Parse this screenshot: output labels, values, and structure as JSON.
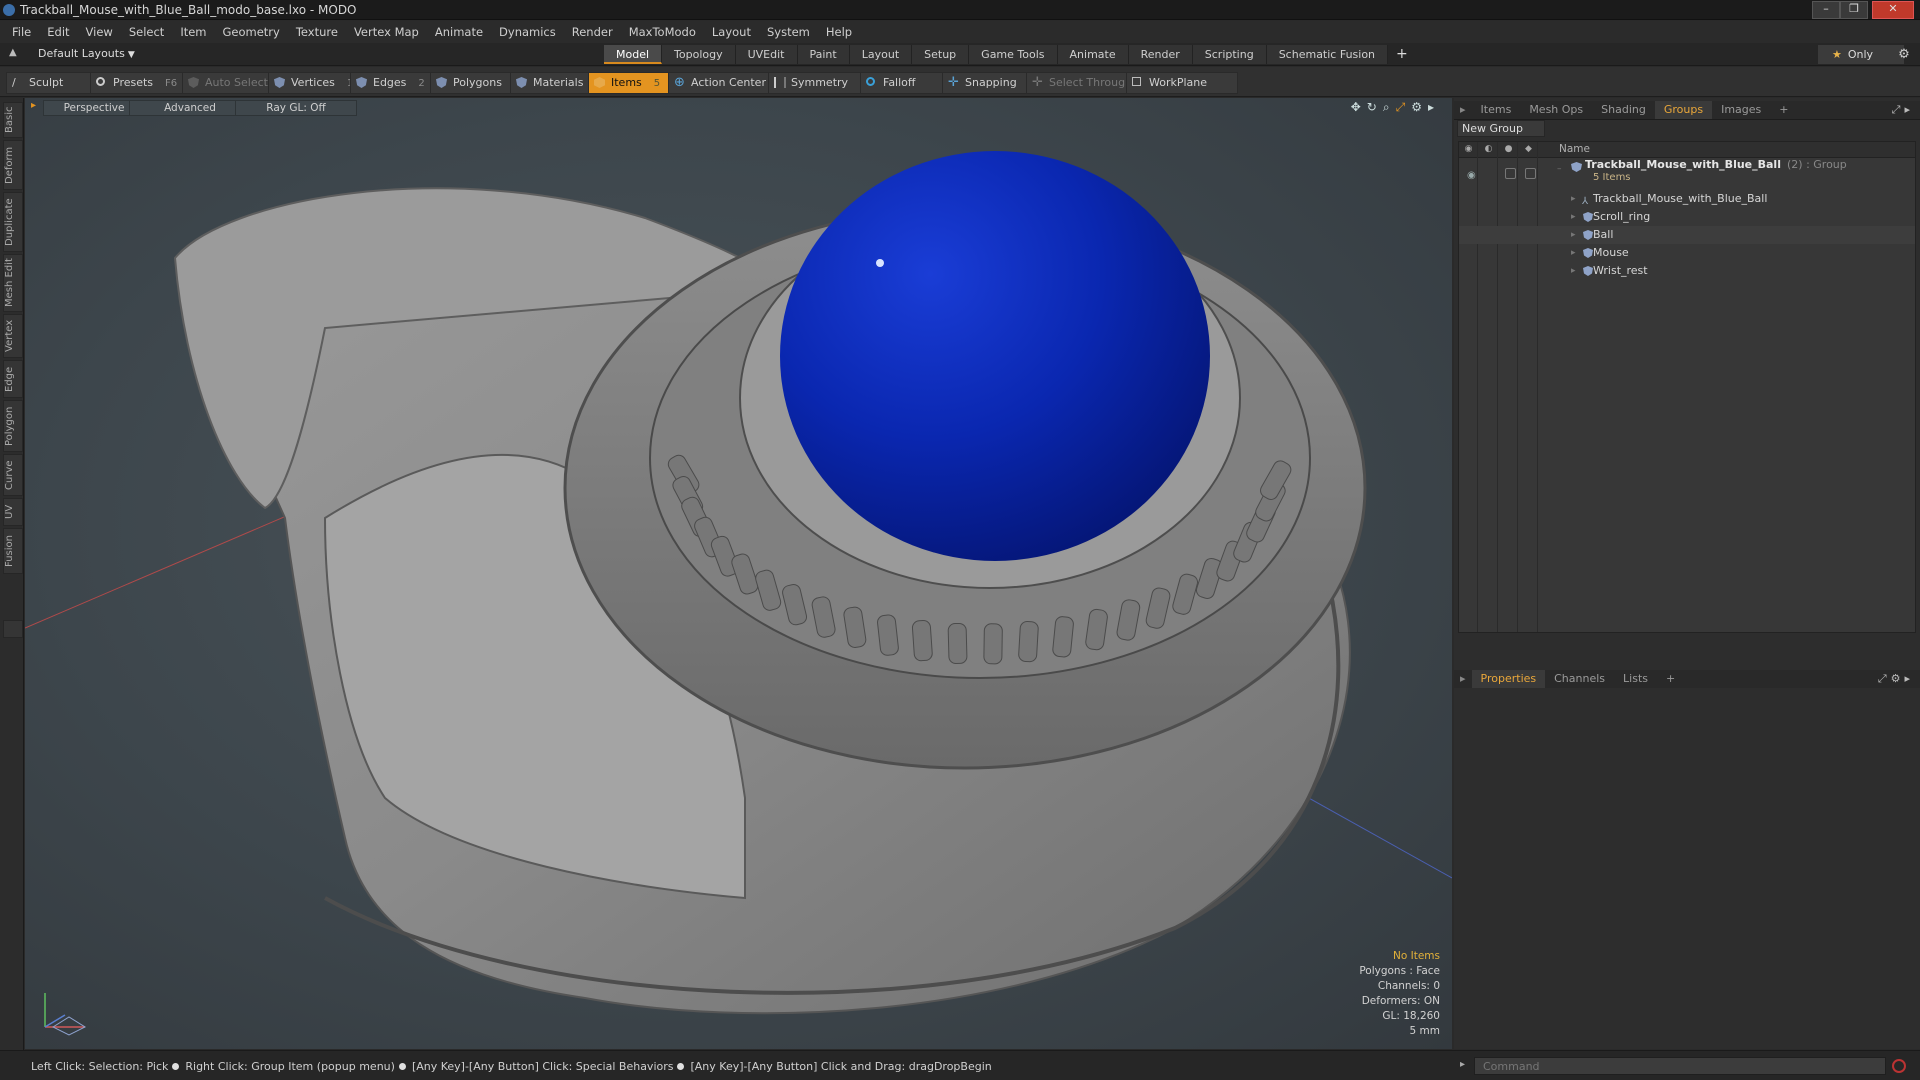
{
  "window": {
    "title": "Trackball_Mouse_with_Blue_Ball_modo_base.lxo - MODO"
  },
  "menu": [
    "File",
    "Edit",
    "View",
    "Select",
    "Item",
    "Geometry",
    "Texture",
    "Vertex Map",
    "Animate",
    "Dynamics",
    "Render",
    "MaxToModo",
    "Layout",
    "System",
    "Help"
  ],
  "layout_selector": "Default Layouts",
  "layout_tabs": [
    "Model",
    "Topology",
    "UVEdit",
    "Paint",
    "Layout",
    "Setup",
    "Game Tools",
    "Animate",
    "Render",
    "Scripting",
    "Schematic Fusion"
  ],
  "active_layout_tab": "Model",
  "only_label": "Only",
  "toolbar": {
    "sculpt": "Sculpt",
    "presets": "Presets",
    "presets_key": "F6",
    "auto_select": "Auto Select",
    "vertices": "Vertices",
    "vertices_count": "1",
    "edges": "Edges",
    "edges_count": "2",
    "polygons": "Polygons",
    "materials": "Materials",
    "items": "Items",
    "items_count": "5",
    "action_center": "Action Center",
    "symmetry": "Symmetry",
    "falloff": "Falloff",
    "snapping": "Snapping",
    "select_through": "Select Through",
    "workplane": "WorkPlane"
  },
  "left_tabs": [
    "Basic",
    "Deform",
    "Duplicate",
    "Mesh Edit",
    "Vertex",
    "Edge",
    "Polygon",
    "Curve",
    "UV",
    "Fusion"
  ],
  "viewport": {
    "view": "Perspective",
    "shading": "Advanced",
    "raygl": "Ray GL: Off",
    "info": {
      "selection": "No Items",
      "polygons": "Polygons : Face",
      "channels": "Channels: 0",
      "deformers": "Deformers: ON",
      "gl": "GL: 18,260",
      "unit": "5 mm"
    }
  },
  "colors": {
    "accent": "#e49420",
    "ball": "#0a1f9e",
    "body": "#8a8a8a"
  },
  "right_panel": {
    "tabs": [
      "Items",
      "Mesh Ops",
      "Shading",
      "Groups",
      "Images"
    ],
    "active_tab": "Groups",
    "new_group": "New Group",
    "column_name": "Name",
    "group": {
      "name": "Trackball_Mouse_with_Blue_Ball",
      "meta": "(2) : Group",
      "count": "5 Items"
    },
    "items": [
      "Trackball_Mouse_with_Blue_Ball",
      "Scroll_ring",
      "Ball",
      "Mouse",
      "Wrist_rest"
    ]
  },
  "bottom_panel": {
    "tabs": [
      "Properties",
      "Channels",
      "Lists"
    ],
    "active_tab": "Properties"
  },
  "status": {
    "hint1": "Left Click: Selection: Pick",
    "hint2": "Right Click: Group Item (popup menu)",
    "hint3": "[Any Key]-[Any Button] Click: Special Behaviors",
    "hint4": "[Any Key]-[Any Button] Click and Drag: dragDropBegin",
    "command_placeholder": "Command"
  }
}
